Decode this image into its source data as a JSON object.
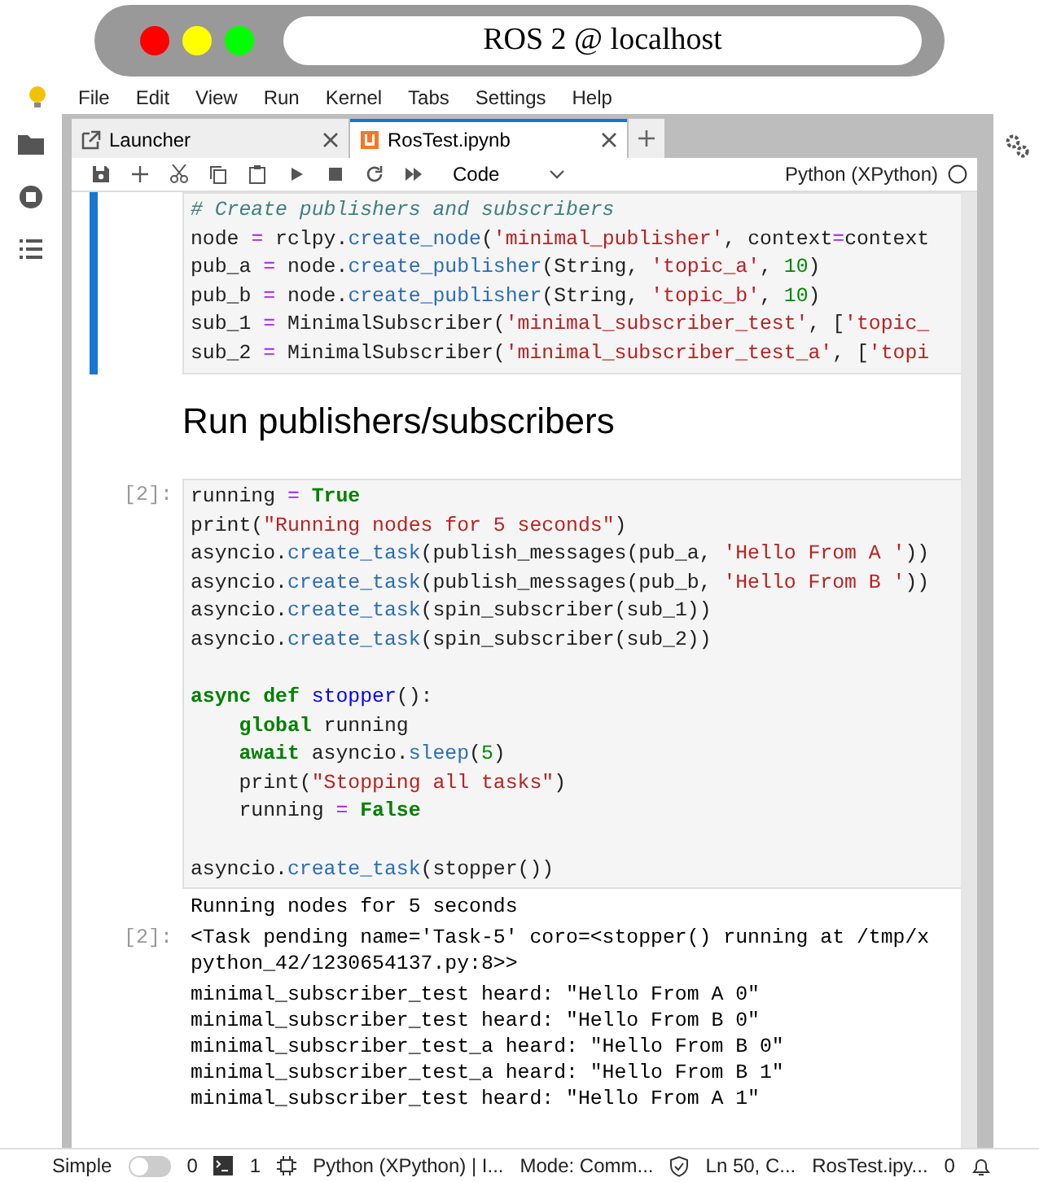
{
  "window": {
    "title": "ROS 2 @ localhost"
  },
  "menu": [
    "File",
    "Edit",
    "View",
    "Run",
    "Kernel",
    "Tabs",
    "Settings",
    "Help"
  ],
  "tabs": [
    {
      "label": "Launcher",
      "kind": "launcher",
      "selected": false
    },
    {
      "label": "RosTest.ipynb",
      "kind": "notebook",
      "selected": true
    }
  ],
  "toolbar": {
    "cell_type": "Code",
    "kernel": "Python (XPython)",
    "kernel_busy": false
  },
  "cells": [
    {
      "kind": "code",
      "selected": true,
      "code_blocks": [
        [
          [
            {
              "kind": "comment",
              "text": "# Create publishers and subscribers"
            }
          ],
          [
            {
              "kind": "plain",
              "text": "node "
            },
            {
              "kind": "operator",
              "text": "="
            },
            {
              "kind": "plain",
              "text": " rclpy."
            },
            {
              "kind": "function",
              "text": "create_node"
            },
            {
              "kind": "plain",
              "text": "("
            },
            {
              "kind": "string",
              "text": "'minimal_publisher'"
            },
            {
              "kind": "plain",
              "text": ", context"
            },
            {
              "kind": "operator",
              "text": "="
            },
            {
              "kind": "plain",
              "text": "context"
            }
          ],
          [
            {
              "kind": "plain",
              "text": "pub_a "
            },
            {
              "kind": "operator",
              "text": "="
            },
            {
              "kind": "plain",
              "text": " node."
            },
            {
              "kind": "function",
              "text": "create_publisher"
            },
            {
              "kind": "plain",
              "text": "(String, "
            },
            {
              "kind": "string",
              "text": "'topic_a'"
            },
            {
              "kind": "plain",
              "text": ", "
            },
            {
              "kind": "number",
              "text": "10"
            },
            {
              "kind": "plain",
              "text": ")"
            }
          ],
          [
            {
              "kind": "plain",
              "text": "pub_b "
            },
            {
              "kind": "operator",
              "text": "="
            },
            {
              "kind": "plain",
              "text": " node."
            },
            {
              "kind": "function",
              "text": "create_publisher"
            },
            {
              "kind": "plain",
              "text": "(String, "
            },
            {
              "kind": "string",
              "text": "'topic_b'"
            },
            {
              "kind": "plain",
              "text": ", "
            },
            {
              "kind": "number",
              "text": "10"
            },
            {
              "kind": "plain",
              "text": ")"
            }
          ],
          [
            {
              "kind": "plain",
              "text": "sub_1 "
            },
            {
              "kind": "operator",
              "text": "="
            },
            {
              "kind": "plain",
              "text": " MinimalSubscriber("
            },
            {
              "kind": "string",
              "text": "'minimal_subscriber_test'"
            },
            {
              "kind": "plain",
              "text": ", ["
            },
            {
              "kind": "string",
              "text": "'topic_"
            }
          ],
          [
            {
              "kind": "plain",
              "text": "sub_2 "
            },
            {
              "kind": "operator",
              "text": "="
            },
            {
              "kind": "plain",
              "text": " MinimalSubscriber("
            },
            {
              "kind": "string",
              "text": "'minimal_subscriber_test_a'"
            },
            {
              "kind": "plain",
              "text": ", ["
            },
            {
              "kind": "string",
              "text": "'topi"
            }
          ]
        ]
      ]
    },
    {
      "kind": "markdown",
      "selected": false,
      "heading": "Run publishers/subscribers"
    },
    {
      "kind": "code",
      "selected": false,
      "prompt": "[2]:",
      "code_blocks": [
        [
          [
            {
              "kind": "plain",
              "text": "running "
            },
            {
              "kind": "operator",
              "text": "= "
            },
            {
              "kind": "keyword",
              "text": "True"
            }
          ],
          [
            {
              "kind": "plain",
              "text": "print("
            },
            {
              "kind": "string",
              "text": "\"Running nodes for 5 seconds\""
            },
            {
              "kind": "plain",
              "text": ")"
            }
          ],
          [
            {
              "kind": "plain",
              "text": "asyncio."
            },
            {
              "kind": "function",
              "text": "create_task"
            },
            {
              "kind": "plain",
              "text": "(publish_messages(pub_a, "
            },
            {
              "kind": "string",
              "text": "'Hello From A '"
            },
            {
              "kind": "plain",
              "text": "))"
            }
          ],
          [
            {
              "kind": "plain",
              "text": "asyncio."
            },
            {
              "kind": "function",
              "text": "create_task"
            },
            {
              "kind": "plain",
              "text": "(publish_messages(pub_b, "
            },
            {
              "kind": "string",
              "text": "'Hello From B '"
            },
            {
              "kind": "plain",
              "text": "))"
            }
          ],
          [
            {
              "kind": "plain",
              "text": "asyncio."
            },
            {
              "kind": "function",
              "text": "create_task"
            },
            {
              "kind": "plain",
              "text": "(spin_subscriber(sub_1))"
            }
          ],
          [
            {
              "kind": "plain",
              "text": "asyncio."
            },
            {
              "kind": "function",
              "text": "create_task"
            },
            {
              "kind": "plain",
              "text": "(spin_subscriber(sub_2))"
            }
          ]
        ],
        [
          [
            {
              "kind": "keyword",
              "text": "async def "
            },
            {
              "kind": "defname",
              "text": "stopper"
            },
            {
              "kind": "plain",
              "text": "():"
            }
          ],
          [
            {
              "kind": "keyword",
              "text": "    global"
            },
            {
              "kind": "plain",
              "text": " running"
            }
          ],
          [
            {
              "kind": "keyword",
              "text": "    await"
            },
            {
              "kind": "plain",
              "text": " asyncio."
            },
            {
              "kind": "function",
              "text": "sleep"
            },
            {
              "kind": "plain",
              "text": "("
            },
            {
              "kind": "number",
              "text": "5"
            },
            {
              "kind": "plain",
              "text": ")"
            }
          ],
          [
            {
              "kind": "plain",
              "text": "    print("
            },
            {
              "kind": "string",
              "text": "\"Stopping all tasks\""
            },
            {
              "kind": "plain",
              "text": ")"
            }
          ],
          [
            {
              "kind": "plain",
              "text": "    running "
            },
            {
              "kind": "operator",
              "text": "= "
            },
            {
              "kind": "keyword",
              "text": "False"
            }
          ]
        ],
        [
          [
            {
              "kind": "plain",
              "text": "asyncio."
            },
            {
              "kind": "function",
              "text": "create_task"
            },
            {
              "kind": "plain",
              "text": "(stopper())"
            }
          ]
        ]
      ],
      "outputs": [
        {
          "kind": "stream",
          "lines": [
            "Running nodes for 5 seconds"
          ]
        },
        {
          "kind": "result",
          "prompt": "[2]:",
          "lines": [
            "<Task pending name='Task-5' coro=<stopper() running at /tmp/x",
            "python_42/1230654137.py:8>>"
          ]
        },
        {
          "kind": "stream",
          "lines": [
            "minimal_subscriber_test heard: \"Hello From A 0\"",
            "minimal_subscriber_test heard: \"Hello From B 0\"",
            "minimal_subscriber_test_a heard: \"Hello From B 0\"",
            "minimal_subscriber_test_a heard: \"Hello From B 1\"",
            "minimal_subscriber_test heard: \"Hello From A 1\""
          ]
        }
      ]
    }
  ],
  "status_bar": {
    "simple_label": "Simple",
    "simple_on": false,
    "terminals": "0",
    "kernels": "1",
    "kernel": "Python (XPython) | I...",
    "mode": "Mode: Comm...",
    "position": "Ln 50, C...",
    "file": "RosTest.ipy...",
    "notifications": "0"
  }
}
